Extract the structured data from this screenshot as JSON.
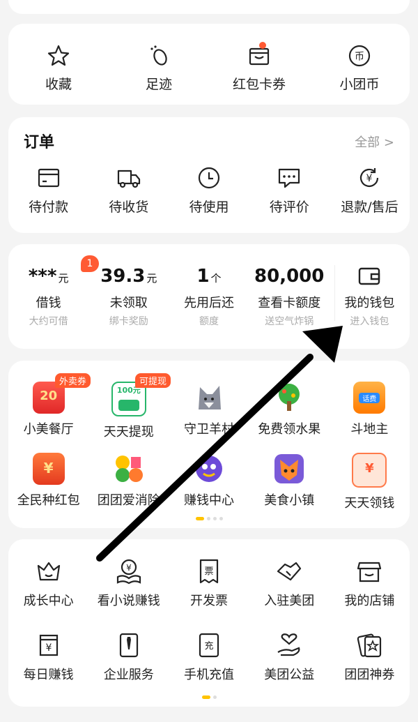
{
  "quick": [
    {
      "label": "收藏",
      "icon": "star-icon"
    },
    {
      "label": "足迹",
      "icon": "footprint-icon"
    },
    {
      "label": "红包卡券",
      "icon": "coupon-icon"
    },
    {
      "label": "小团币",
      "icon": "coin-icon",
      "symbol": "币"
    }
  ],
  "orders": {
    "title": "订单",
    "all": "全部 >",
    "items": [
      {
        "label": "待付款",
        "icon": "card-icon"
      },
      {
        "label": "待收货",
        "icon": "truck-icon"
      },
      {
        "label": "待使用",
        "icon": "clock-icon"
      },
      {
        "label": "待评价",
        "icon": "comment-icon"
      },
      {
        "label": "退款/售后",
        "icon": "refund-icon"
      }
    ]
  },
  "finance": {
    "badge": "1",
    "items": [
      {
        "value": "***",
        "unit": "元",
        "name": "借钱",
        "sub": "大约可借"
      },
      {
        "value": "39.3",
        "unit": "元",
        "name": "未领取",
        "sub": "绑卡奖励"
      },
      {
        "value": "1",
        "unit": "个",
        "name": "先用后还",
        "sub": "额度"
      },
      {
        "value": "80,000",
        "unit": "",
        "name": "查看卡额度",
        "sub": "送空气炸锅"
      },
      {
        "value": "",
        "unit": "",
        "name": "我的钱包",
        "sub": "进入钱包"
      }
    ]
  },
  "apps": {
    "row1": [
      {
        "label": "小美餐厅",
        "tag": "外卖券",
        "glyph": "20"
      },
      {
        "label": "天天提现",
        "tag": "可提现",
        "glyph": "100元"
      },
      {
        "label": "守卫羊村",
        "tag": "",
        "glyph": ""
      },
      {
        "label": "免费领水果",
        "tag": "",
        "glyph": ""
      },
      {
        "label": "斗地主",
        "tag": "",
        "glyph": "话费"
      }
    ],
    "row2": [
      {
        "label": "全民种红包",
        "glyph": "¥"
      },
      {
        "label": "团团爱消除",
        "glyph": ""
      },
      {
        "label": "赚钱中心",
        "glyph": ""
      },
      {
        "label": "美食小镇",
        "glyph": ""
      },
      {
        "label": "天天领钱",
        "glyph": "¥"
      }
    ]
  },
  "tools": {
    "row1": [
      {
        "label": "成长中心",
        "icon": "crown-icon"
      },
      {
        "label": "看小说赚钱",
        "icon": "book-icon",
        "glyph": "¥"
      },
      {
        "label": "开发票",
        "icon": "invoice-icon",
        "glyph": "票"
      },
      {
        "label": "入驻美团",
        "icon": "handshake-icon"
      },
      {
        "label": "我的店铺",
        "icon": "store-icon"
      }
    ],
    "row2": [
      {
        "label": "每日赚钱",
        "icon": "money-bag-icon",
        "glyph": "¥"
      },
      {
        "label": "企业服务",
        "icon": "tie-icon"
      },
      {
        "label": "手机充值",
        "icon": "recharge-icon",
        "glyph": "充"
      },
      {
        "label": "美团公益",
        "icon": "charity-icon"
      },
      {
        "label": "团团神券",
        "icon": "lucky-coupon-icon"
      }
    ]
  },
  "colors": {
    "accent": "#ffc300",
    "badge": "#ff5a33",
    "arrow": "#000000"
  }
}
